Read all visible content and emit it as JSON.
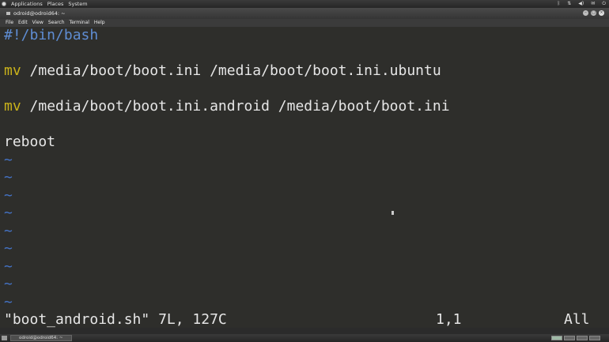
{
  "top_panel": {
    "menus": [
      "Applications",
      "Places",
      "System"
    ],
    "tray_icons": [
      "bluetooth-icon",
      "network-icon",
      "volume-icon",
      "mail-icon",
      "power-icon"
    ]
  },
  "window": {
    "title": "odroid@odroid64: ~",
    "menu": [
      "File",
      "Edit",
      "View",
      "Search",
      "Terminal",
      "Help"
    ]
  },
  "editor": {
    "lines": [
      {
        "prefix": "#!/bin/bash",
        "rest": ""
      },
      {
        "prefix": "mv",
        "rest": " /media/boot/boot.ini /media/boot/boot.ini.ubuntu"
      },
      {
        "prefix": "mv",
        "rest": " /media/boot/boot.ini.android /media/boot/boot.ini"
      },
      {
        "prefix": "",
        "rest": "reboot"
      }
    ],
    "tilde": "~",
    "tilde_count": 9,
    "status_file": "\"boot_android.sh\" 7L, 127C",
    "status_position": "1,1",
    "status_scroll": "All",
    "colors": {
      "shebang": "#5f8dd3",
      "command": "#c9b21b",
      "tilde": "#4472c4",
      "background": "#2e2e2b"
    }
  },
  "bottom_panel": {
    "task_label": "odroid@odroid64: ~"
  }
}
